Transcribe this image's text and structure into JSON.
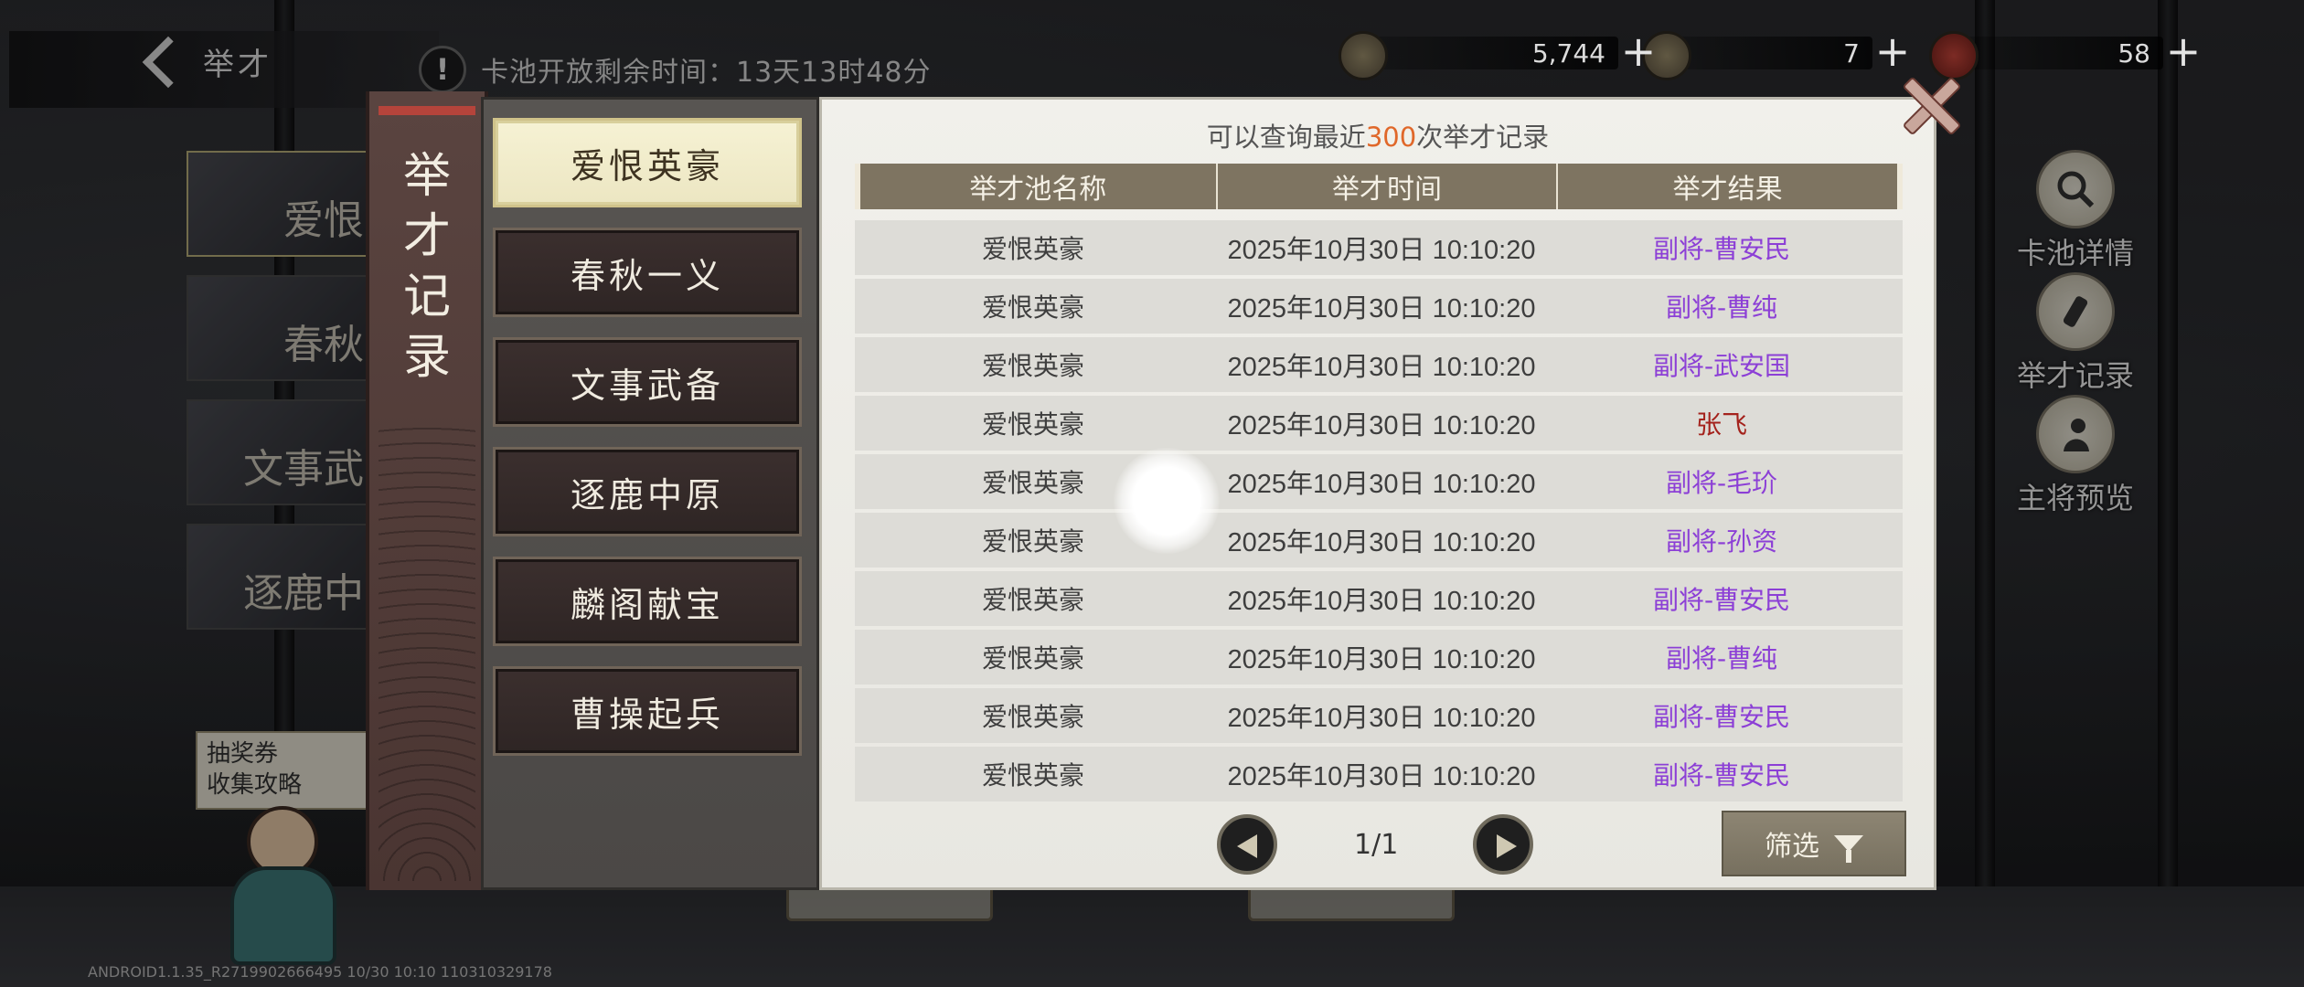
{
  "header": {
    "title": "举才",
    "timer_text": "卡池开放剩余时间：13天13时48分",
    "alert_glyph": "!"
  },
  "currencies": [
    {
      "icon": "copper-coin-icon",
      "value": "5,744"
    },
    {
      "icon": "jade-token-icon",
      "value": "7"
    },
    {
      "icon": "treasure-icon",
      "value": "58"
    }
  ],
  "left_banners": [
    "爱恨",
    "春秋",
    "文事武",
    "逐鹿中"
  ],
  "lottery_panel": {
    "line1": "抽奖券",
    "line2": "收集攻略"
  },
  "side_buttons": [
    {
      "label": "卡池详情",
      "icon": "magnifier-icon"
    },
    {
      "label": "举才记录",
      "icon": "scroll-icon"
    },
    {
      "label": "主将预览",
      "icon": "general-icon"
    }
  ],
  "version": "ANDROID1.1.35_R2719902666495 10/30 10:10 110310329178",
  "modal": {
    "title": "举才记录",
    "notice_prefix": "可以查询最近",
    "notice_count": "300",
    "notice_suffix": "次举才记录",
    "pools": [
      "爱恨英豪",
      "春秋一义",
      "文事武备",
      "逐鹿中原",
      "麟阁献宝",
      "曹操起兵"
    ],
    "selected_pool": "爱恨英豪",
    "columns": [
      "举才池名称",
      "举才时间",
      "举才结果"
    ],
    "rows": [
      {
        "pool": "爱恨英豪",
        "time": "2025年10月30日 10:10:20",
        "result": "副将-曹安民",
        "rarity": "purple"
      },
      {
        "pool": "爱恨英豪",
        "time": "2025年10月30日 10:10:20",
        "result": "副将-曹纯",
        "rarity": "purple"
      },
      {
        "pool": "爱恨英豪",
        "time": "2025年10月30日 10:10:20",
        "result": "副将-武安国",
        "rarity": "purple"
      },
      {
        "pool": "爱恨英豪",
        "time": "2025年10月30日 10:10:20",
        "result": "张飞",
        "rarity": "red"
      },
      {
        "pool": "爱恨英豪",
        "time": "2025年10月30日 10:10:20",
        "result": "副将-毛玠",
        "rarity": "purple"
      },
      {
        "pool": "爱恨英豪",
        "time": "2025年10月30日 10:10:20",
        "result": "副将-孙资",
        "rarity": "purple"
      },
      {
        "pool": "爱恨英豪",
        "time": "2025年10月30日 10:10:20",
        "result": "副将-曹安民",
        "rarity": "purple"
      },
      {
        "pool": "爱恨英豪",
        "time": "2025年10月30日 10:10:20",
        "result": "副将-曹纯",
        "rarity": "purple"
      },
      {
        "pool": "爱恨英豪",
        "time": "2025年10月30日 10:10:20",
        "result": "副将-曹安民",
        "rarity": "purple"
      },
      {
        "pool": "爱恨英豪",
        "time": "2025年10月30日 10:10:20",
        "result": "副将-曹安民",
        "rarity": "purple"
      }
    ],
    "page_indicator": "1/1",
    "filter_label": "筛选"
  },
  "colors": {
    "accent_orange": "#e0682a",
    "purple": "#8c3fd6",
    "red": "#a4221c",
    "header": "#7e7461"
  }
}
